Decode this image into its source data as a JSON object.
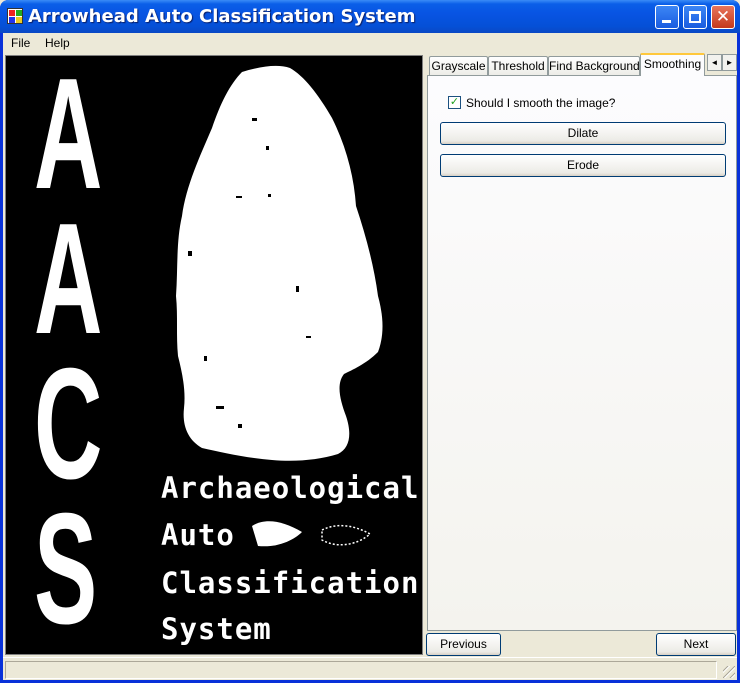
{
  "window": {
    "title": "Arrowhead Auto Classification System",
    "accent_color": "#0a5fe8",
    "close_color": "#c4391b",
    "icons": {
      "minimize": "minimize-icon",
      "maximize": "maximize-icon",
      "close": "close-icon",
      "app": "app-icon"
    }
  },
  "menu": {
    "items": [
      "File",
      "Help"
    ]
  },
  "image_panel": {
    "letters": [
      "A",
      "A",
      "C",
      "S"
    ],
    "tagline": [
      "Archaeological",
      "Auto",
      "Classification",
      "System"
    ]
  },
  "tabs": {
    "items": [
      "Grayscale",
      "Threshold",
      "Find Background",
      "Smoothing"
    ],
    "active": "Smoothing",
    "scroll_left": "◄",
    "scroll_right": "►"
  },
  "smoothing": {
    "checkbox_label": "Should I smooth the image?",
    "checkbox_checked": true,
    "check_mark": "✓",
    "dilate_label": "Dilate",
    "erode_label": "Erode"
  },
  "nav": {
    "previous_label": "Previous",
    "next_label": "Next"
  }
}
